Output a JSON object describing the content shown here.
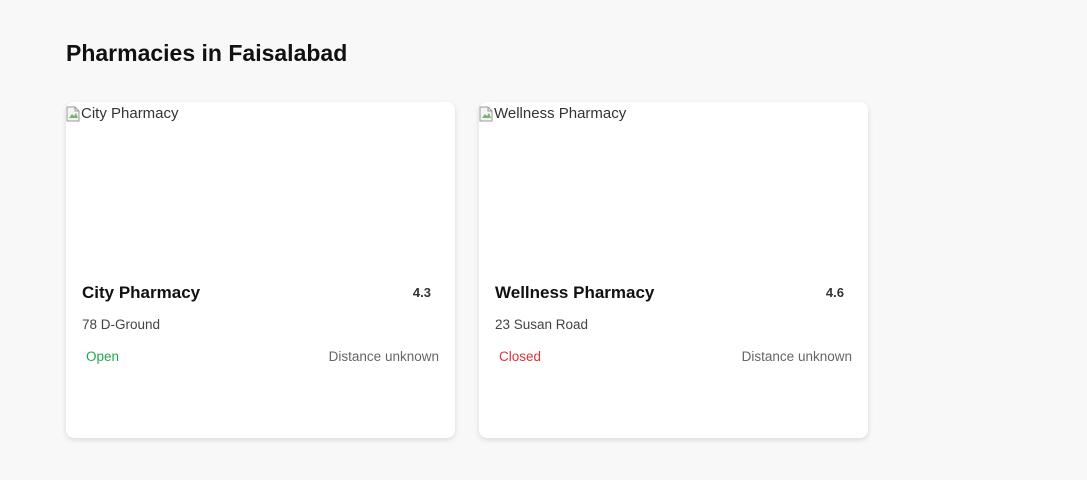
{
  "page": {
    "title": "Pharmacies in Faisalabad"
  },
  "pharmacies": [
    {
      "image_alt": "City Pharmacy",
      "name": "City Pharmacy",
      "rating": "4.3",
      "address": "78 D-Ground",
      "status": "Open",
      "status_color": "#22a84a",
      "distance": "Distance unknown"
    },
    {
      "image_alt": "Wellness Pharmacy",
      "name": "Wellness Pharmacy",
      "rating": "4.6",
      "address": "23 Susan Road",
      "status": "Closed",
      "status_color": "#e0303a",
      "distance": "Distance unknown"
    }
  ],
  "icons": {
    "broken_image": "broken-image-icon"
  }
}
